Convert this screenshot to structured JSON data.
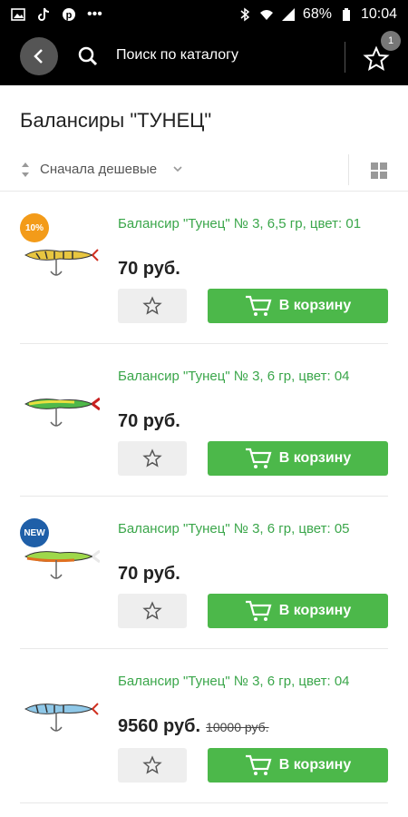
{
  "status": {
    "battery": "68%",
    "time": "10:04"
  },
  "header": {
    "search_placeholder": "Поиск по каталогу",
    "favorites_count": "1"
  },
  "page": {
    "title": "Балансиры \"ТУНЕЦ\""
  },
  "sort": {
    "label": "Сначала дешевые"
  },
  "products": [
    {
      "name": "Балансир \"Тунец\" № 3, 6,5 гр, цвет: 01",
      "price": "70 руб.",
      "old_price": "",
      "badge": "10%",
      "badge_color": "#f39b19",
      "cart_label": "В корзину"
    },
    {
      "name": "Балансир \"Тунец\" № 3, 6 гр, цвет: 04",
      "price": "70 руб.",
      "old_price": "",
      "badge": "",
      "badge_color": "",
      "cart_label": "В корзину"
    },
    {
      "name": "Балансир \"Тунец\" № 3, 6 гр, цвет: 05",
      "price": "70 руб.",
      "old_price": "",
      "badge": "NEW",
      "badge_color": "#1f5fa8",
      "cart_label": "В корзину"
    },
    {
      "name": "Балансир \"Тунец\" № 3, 6 гр, цвет: 04",
      "price": "9560 руб.",
      "old_price": "10000 руб.",
      "badge": "",
      "badge_color": "",
      "cart_label": "В корзину"
    }
  ],
  "colors": {
    "accent_green": "#4cb84a",
    "link_green": "#3aa64a",
    "header_bg": "#000000"
  }
}
